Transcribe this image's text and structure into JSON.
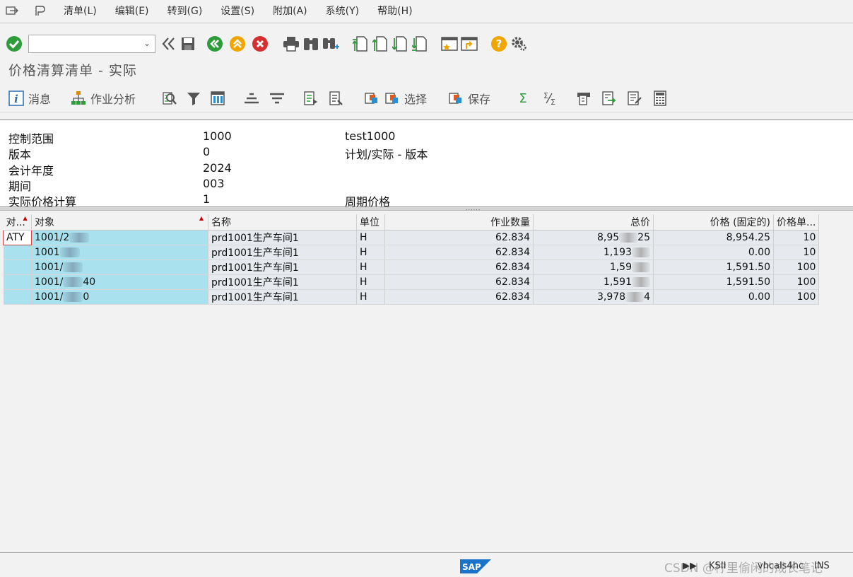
{
  "menubar": {
    "items": [
      "清单(L)",
      "编辑(E)",
      "转到(G)",
      "设置(S)",
      "附加(A)",
      "系统(Y)",
      "帮助(H)"
    ]
  },
  "toolbar": {
    "command_field_value": ""
  },
  "title": "价格清算清单 - 实际",
  "app_toolbar": {
    "messages_label": "消息",
    "activity_analysis_label": "作业分析",
    "select_label": "选择",
    "save_label": "保存"
  },
  "header": {
    "rows": [
      {
        "key": "控制范围",
        "value": "1000",
        "desc": "test1000"
      },
      {
        "key": "版本",
        "value": "0",
        "desc": "计划/实际 - 版本"
      },
      {
        "key": "会计年度",
        "value": "2024",
        "desc": ""
      },
      {
        "key": "期间",
        "value": "003",
        "desc": ""
      },
      {
        "key": "实际价格计算",
        "value": "1",
        "desc": "周期价格"
      }
    ]
  },
  "grid": {
    "columns": [
      "对...",
      "对象",
      "名称",
      "单位",
      "作业数量",
      "总价",
      "价格 (固定的)",
      "价格单..."
    ],
    "rows": [
      {
        "type": "ATY",
        "object": "1001/2",
        "name": "prd1001生产车间1",
        "unit": "H",
        "qty": "62.834",
        "total": "8,95",
        "total_tail": "25",
        "price": "8,954.25",
        "price_unit": "10"
      },
      {
        "type": "",
        "object": "1001",
        "name": "prd1001生产车间1",
        "unit": "H",
        "qty": "62.834",
        "total": "1,193",
        "total_tail": "",
        "price": "0.00",
        "price_unit": "10"
      },
      {
        "type": "",
        "object": "1001/",
        "name": "prd1001生产车间1",
        "unit": "H",
        "qty": "62.834",
        "total": "1,59",
        "total_tail": "",
        "price": "1,591.50",
        "price_unit": "100"
      },
      {
        "type": "",
        "object": "1001/",
        "object_tail": "40",
        "name": "prd1001生产车间1",
        "unit": "H",
        "qty": "62.834",
        "total": "1,591",
        "total_tail": "",
        "price": "1,591.50",
        "price_unit": "100"
      },
      {
        "type": "",
        "object": "1001/",
        "object_tail": "0",
        "name": "prd1001生产车间1",
        "unit": "H",
        "qty": "62.834",
        "total": "3,978",
        "total_tail": "4",
        "price": "0.00",
        "price_unit": "100"
      }
    ]
  },
  "status": {
    "system": "KSII",
    "host": "vhcals4hc",
    "mode": "INS",
    "watermark": "CSDN @柠里偷闲的成长笔记"
  }
}
